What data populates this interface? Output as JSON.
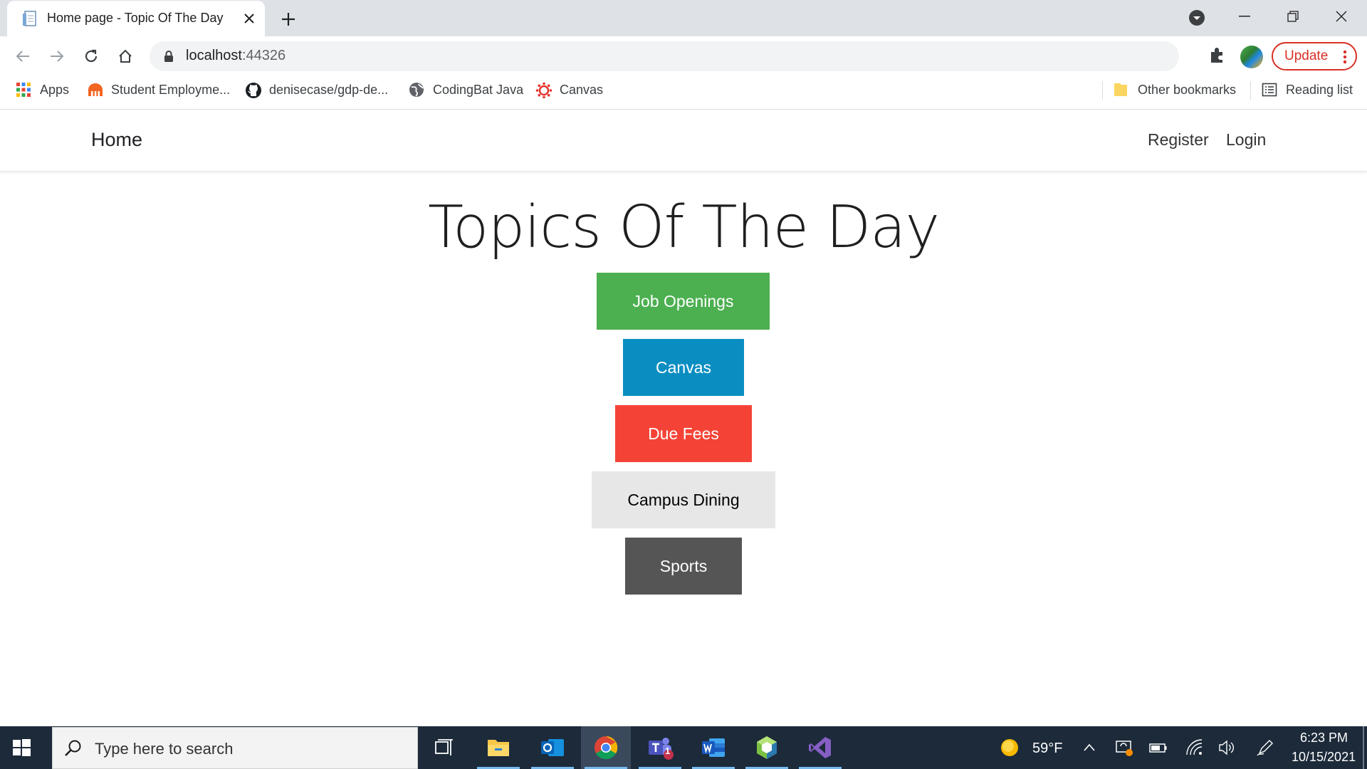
{
  "browser": {
    "tab_title": "Home page - Topic Of The Day",
    "url_host": "localhost",
    "url_port": ":44326",
    "update_label": "Update",
    "bookmarks": [
      {
        "label": "Apps",
        "icon": "apps-grid-icon"
      },
      {
        "label": "Student Employme...",
        "icon": "student-employment-icon"
      },
      {
        "label": "denisecase/gdp-de...",
        "icon": "github-icon"
      },
      {
        "label": "CodingBat Java",
        "icon": "globe-icon"
      },
      {
        "label": "Canvas",
        "icon": "canvas-icon"
      }
    ],
    "other_bookmarks": "Other bookmarks",
    "reading_list": "Reading list"
  },
  "site": {
    "brand": "Home",
    "nav_register": "Register",
    "nav_login": "Login",
    "title": "Topics Of The Day",
    "topics": [
      {
        "label": "Job Openings",
        "bg": "#4caf50",
        "fg": "#ffffff"
      },
      {
        "label": "Canvas",
        "bg": "#0a8ec2",
        "fg": "#ffffff"
      },
      {
        "label": "Due Fees",
        "bg": "#f44336",
        "fg": "#ffffff"
      },
      {
        "label": "Campus Dining",
        "bg": "#e7e7e7",
        "fg": "#000000"
      },
      {
        "label": "Sports",
        "bg": "#555555",
        "fg": "#ffffff"
      }
    ]
  },
  "taskbar": {
    "search_placeholder": "Type here to search",
    "weather": "59°F",
    "time": "6:23 PM",
    "date": "10/15/2021",
    "teams_badge": "1"
  },
  "colors": {
    "accent_update": "#d93025",
    "taskbar_bg": "#1c2a3a"
  }
}
